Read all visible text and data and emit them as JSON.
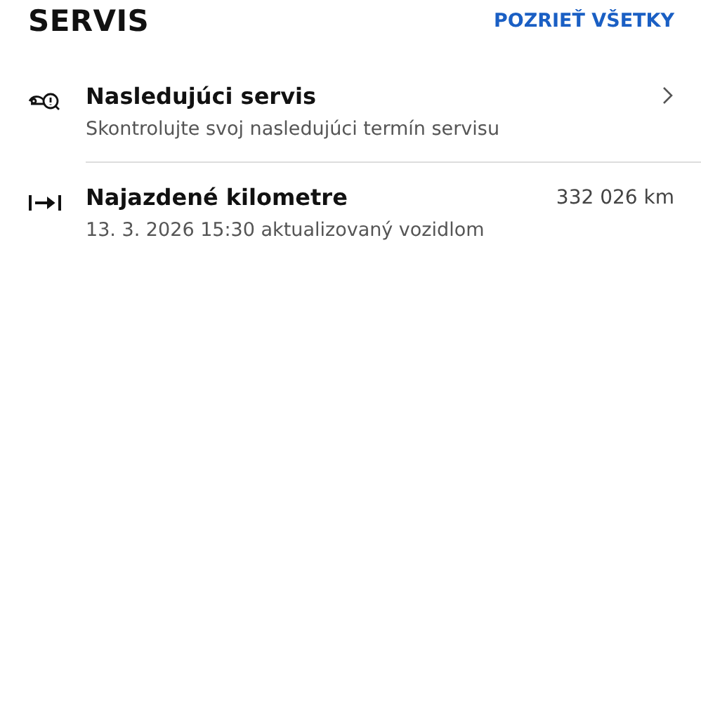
{
  "header": {
    "title": "SERVIS",
    "link": "POZRIEŤ VŠETKY"
  },
  "items": [
    {
      "kind": "link",
      "title": "Nasledujúci servis",
      "subtitle": "Skontrolujte svoj nasledujúci termín servisu"
    },
    {
      "kind": "value",
      "title": "Najazdené kilometre",
      "subtitle": "13. 3. 2026 15:30 aktualizovaný vozidlom",
      "value": "332 026 km"
    }
  ]
}
